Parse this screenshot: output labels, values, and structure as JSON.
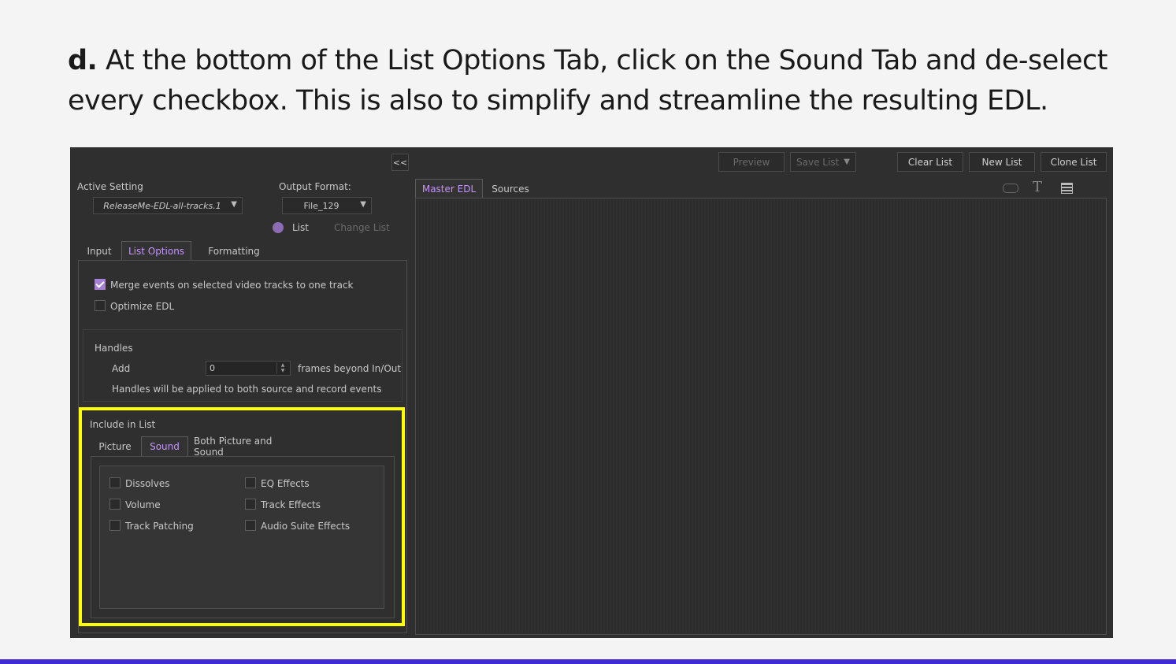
{
  "instruction": {
    "step": "d.",
    "text": "At the bottom of the List Options Tab, click on the Sound Tab and de-select every checkbox. This is also to simplify and streamline the resulting EDL."
  },
  "toolbar": {
    "collapse_label": "<<",
    "preview_label": "Preview",
    "save_list_label": "Save List",
    "clear_list_label": "Clear List",
    "new_list_label": "New List",
    "clone_list_label": "Clone List"
  },
  "settings": {
    "active_setting_label": "Active Setting",
    "active_setting_value": "ReleaseMe-EDL-all-tracks.1",
    "output_format_label": "Output Format:",
    "output_format_value": "File_129",
    "list_radio_label": "List",
    "change_list_label": "Change List"
  },
  "tabs": {
    "input": "Input",
    "list_options": "List Options",
    "formatting": "Formatting"
  },
  "list_options": {
    "merge_label": "Merge events on selected video tracks to one track",
    "merge_checked": true,
    "optimize_label": "Optimize EDL",
    "optimize_checked": false
  },
  "handles": {
    "title": "Handles",
    "add_label": "Add",
    "add_value": "0",
    "suffix": "frames beyond In/Out",
    "note": "Handles will be applied to both source and record events"
  },
  "include": {
    "title": "Include in List",
    "tab_picture": "Picture",
    "tab_sound": "Sound",
    "tab_both": "Both Picture and Sound",
    "checkboxes": {
      "dissolves": "Dissolves",
      "volume": "Volume",
      "track_patching": "Track Patching",
      "eq_effects": "EQ Effects",
      "track_effects": "Track Effects",
      "audio_suite_effects": "Audio Suite Effects"
    }
  },
  "right_panel": {
    "tab_master_edl": "Master EDL",
    "tab_sources": "Sources"
  },
  "colors": {
    "accent": "#a57fd4",
    "highlight": "#ffff00",
    "bottom_bar": "#3f2ad6"
  }
}
